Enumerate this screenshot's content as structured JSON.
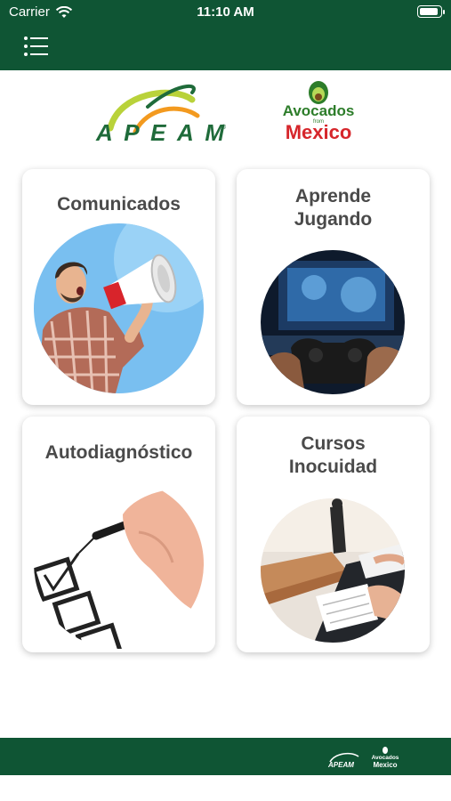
{
  "status_bar": {
    "carrier": "Carrier",
    "time": "11:10 AM"
  },
  "header": {
    "menu_icon": "list-menu-icon"
  },
  "logos": {
    "apeam": "APEAM",
    "avocados_line1": "Avocados",
    "avocados_from": "from",
    "avocados_line2": "Mexico"
  },
  "cards": [
    {
      "title_line1": "Comunicados",
      "title_line2": "",
      "image": "man-with-megaphone"
    },
    {
      "title_line1": "Aprende",
      "title_line2": "Jugando",
      "image": "hands-holding-game-controller"
    },
    {
      "title_line1": "Autodiagnóstico",
      "title_line2": "",
      "image": "hand-checking-boxes"
    },
    {
      "title_line1": "Cursos",
      "title_line2": "Inocuidad",
      "image": "classroom-students-writing"
    }
  ],
  "footer": {
    "apeam": "APEAM",
    "avocados": "Avocados",
    "mexico": "Mexico"
  },
  "colors": {
    "brand_green": "#0f5534",
    "card_title": "#4a4a4a",
    "apeam_green": "#1f6b3a",
    "mexico_red": "#d6262b"
  }
}
